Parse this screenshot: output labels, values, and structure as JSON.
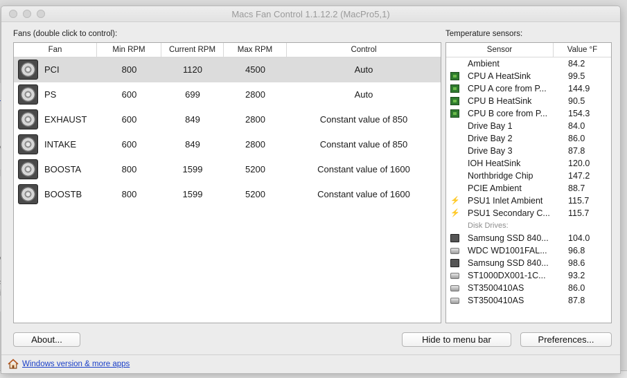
{
  "window": {
    "title": "Macs Fan Control 1.1.12.2 (MacPro5,1)"
  },
  "fans_panel": {
    "label": "Fans (double click to control):",
    "columns": [
      "Fan",
      "Min RPM",
      "Current RPM",
      "Max RPM",
      "Control"
    ],
    "rows": [
      {
        "name": "PCI",
        "min": "800",
        "current": "1120",
        "max": "4500",
        "control": "Auto",
        "selected": true
      },
      {
        "name": "PS",
        "min": "600",
        "current": "699",
        "max": "2800",
        "control": "Auto"
      },
      {
        "name": "EXHAUST",
        "min": "600",
        "current": "849",
        "max": "2800",
        "control": "Constant value of 850"
      },
      {
        "name": "INTAKE",
        "min": "600",
        "current": "849",
        "max": "2800",
        "control": "Constant value of 850"
      },
      {
        "name": "BOOSTA",
        "min": "800",
        "current": "1599",
        "max": "5200",
        "control": "Constant value of 1600"
      },
      {
        "name": "BOOSTB",
        "min": "800",
        "current": "1599",
        "max": "5200",
        "control": "Constant value of 1600"
      }
    ]
  },
  "temps_panel": {
    "label": "Temperature sensors:",
    "columns": [
      "Sensor",
      "Value °F"
    ],
    "sensors": [
      {
        "name": "Ambient",
        "value": "84.2",
        "icon": "none"
      },
      {
        "name": "CPU A HeatSink",
        "value": "99.5",
        "icon": "chip-icon"
      },
      {
        "name": "CPU A core from P...",
        "value": "144.9",
        "icon": "chip-icon"
      },
      {
        "name": "CPU B HeatSink",
        "value": "90.5",
        "icon": "chip-icon"
      },
      {
        "name": "CPU B core from P...",
        "value": "154.3",
        "icon": "chip-icon"
      },
      {
        "name": "Drive Bay 1",
        "value": "84.0",
        "icon": "none"
      },
      {
        "name": "Drive Bay 2",
        "value": "86.0",
        "icon": "none"
      },
      {
        "name": "Drive Bay 3",
        "value": "87.8",
        "icon": "none"
      },
      {
        "name": "IOH HeatSink",
        "value": "120.0",
        "icon": "none"
      },
      {
        "name": "Northbridge Chip",
        "value": "147.2",
        "icon": "none"
      },
      {
        "name": "PCIE Ambient",
        "value": "88.7",
        "icon": "none"
      },
      {
        "name": "PSU1 Inlet Ambient",
        "value": "115.7",
        "icon": "bolt-icon"
      },
      {
        "name": "PSU1 Secondary C...",
        "value": "115.7",
        "icon": "bolt-icon"
      }
    ],
    "disk_group_label": "Disk Drives:",
    "disks": [
      {
        "name": "Samsung SSD 840...",
        "value": "104.0",
        "icon": "ssd-icon"
      },
      {
        "name": "WDC WD1001FAL...",
        "value": "96.8",
        "icon": "hdd-icon"
      },
      {
        "name": "Samsung SSD 840...",
        "value": "98.6",
        "icon": "ssd-icon"
      },
      {
        "name": "ST1000DX001-1C...",
        "value": "93.2",
        "icon": "hdd-icon"
      },
      {
        "name": "ST3500410AS",
        "value": "86.0",
        "icon": "hdd-icon"
      },
      {
        "name": "ST3500410AS",
        "value": "87.8",
        "icon": "hdd-icon"
      }
    ]
  },
  "buttons": {
    "about": "About...",
    "hide": "Hide to menu bar",
    "preferences": "Preferences..."
  },
  "footer": {
    "link": "Windows version & more apps"
  },
  "background_fragments": [
    "Fo",
    "e",
    "p",
    "d",
    "s",
    "ir"
  ]
}
